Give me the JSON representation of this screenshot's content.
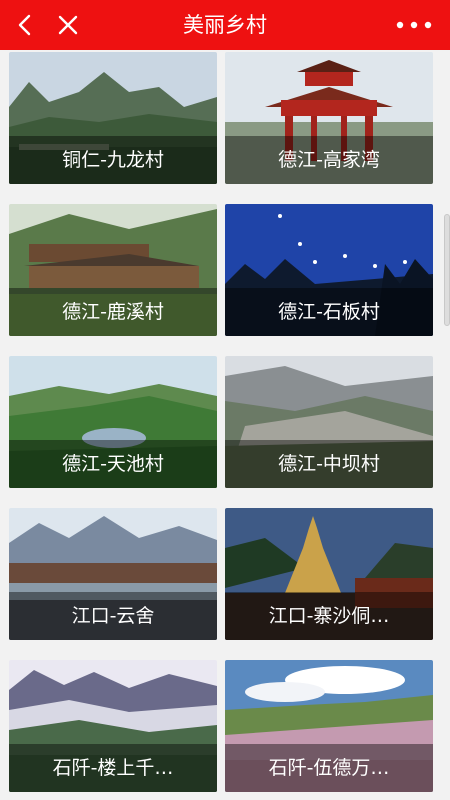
{
  "header": {
    "title": "美丽乡村",
    "colors": {
      "bar": "#ee1111",
      "text": "#ffffff"
    },
    "icons": {
      "back": "chevron-left-icon",
      "close": "close-icon",
      "more": "more-dots-icon"
    }
  },
  "villages": [
    {
      "caption": "铜仁-九龙村"
    },
    {
      "caption": "德江-高家湾"
    },
    {
      "caption": "德江-鹿溪村"
    },
    {
      "caption": "德江-石板村"
    },
    {
      "caption": "德江-天池村"
    },
    {
      "caption": "德江-中坝村"
    },
    {
      "caption": "江口-云舍"
    },
    {
      "caption": "江口-寨沙侗…"
    },
    {
      "caption": "石阡-楼上千…"
    },
    {
      "caption": "石阡-伍德万…"
    }
  ]
}
